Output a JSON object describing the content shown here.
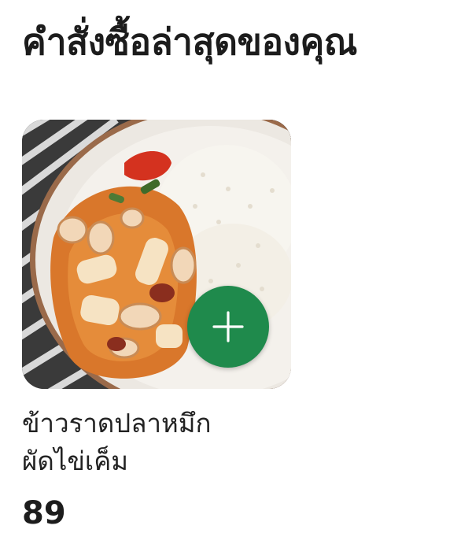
{
  "section": {
    "title": "คำสั่งซื้อล่าสุดของคุณ"
  },
  "product": {
    "name_line1": "ข้าวราดปลาหมึก",
    "name_line2": "ผัดไข่เค็ม",
    "price": "89",
    "add_icon": "plus-icon",
    "image_icon": "food-photo"
  },
  "colors": {
    "add_button": "#1f8a4c",
    "title_text": "#1c1c1c",
    "background": "#ffffff"
  }
}
